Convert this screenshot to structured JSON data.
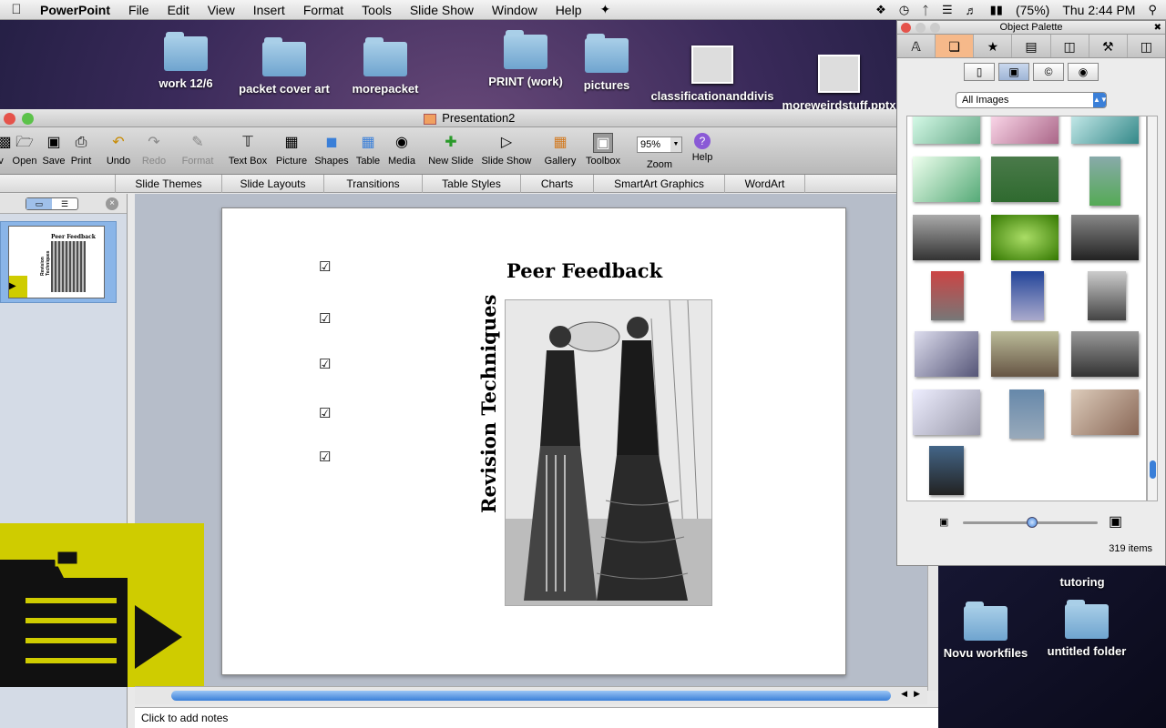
{
  "menubar": {
    "app": "PowerPoint",
    "items": [
      "File",
      "Edit",
      "View",
      "Insert",
      "Format",
      "Tools",
      "Slide Show",
      "Window",
      "Help"
    ],
    "battery": "(75%)",
    "clock": "Thu 2:44 PM"
  },
  "desktop": {
    "icons": [
      {
        "label": "work 12/6",
        "kind": "folder"
      },
      {
        "label": "packet cover art",
        "kind": "folder"
      },
      {
        "label": "morepacket",
        "kind": "folder"
      },
      {
        "label": "PRINT (work)",
        "kind": "folder"
      },
      {
        "label": "pictures",
        "kind": "folder"
      },
      {
        "label": "classificationanddivis",
        "kind": "doc"
      },
      {
        "label": "moreweirdstuff.pptx",
        "kind": "doc"
      }
    ],
    "lower": [
      "tutoring",
      "Novu workfiles",
      "untitled folder"
    ]
  },
  "window": {
    "title": "Presentation2",
    "toolbar": [
      {
        "label": "v",
        "icon": "new-icon"
      },
      {
        "label": "Open",
        "icon": "open-icon"
      },
      {
        "label": "Save",
        "icon": "save-icon"
      },
      {
        "label": "Print",
        "icon": "print-icon"
      },
      {
        "label": "Undo",
        "icon": "undo-icon"
      },
      {
        "label": "Redo",
        "icon": "redo-icon"
      },
      {
        "label": "Format",
        "icon": "format-icon"
      },
      {
        "label": "Text Box",
        "icon": "textbox-icon"
      },
      {
        "label": "Picture",
        "icon": "picture-icon"
      },
      {
        "label": "Shapes",
        "icon": "shapes-icon"
      },
      {
        "label": "Table",
        "icon": "table-icon"
      },
      {
        "label": "Media",
        "icon": "media-icon"
      },
      {
        "label": "New Slide",
        "icon": "new-slide-icon"
      },
      {
        "label": "Slide Show",
        "icon": "slide-show-icon"
      },
      {
        "label": "Gallery",
        "icon": "gallery-icon"
      },
      {
        "label": "Toolbox",
        "icon": "toolbox-icon"
      },
      {
        "label": "Zoom",
        "icon": "zoom-icon"
      },
      {
        "label": "Help",
        "icon": "help-icon"
      }
    ],
    "zoom_value": "95%",
    "ribbon_tabs": [
      "Slide Themes",
      "Slide Layouts",
      "Transitions",
      "Table Styles",
      "Charts",
      "SmartArt Graphics",
      "WordArt"
    ],
    "notes_placeholder": "Click to add notes"
  },
  "slide": {
    "title": "Peer Feedback",
    "vertical_text": "Revision Techniques",
    "checkbox_glyph": "☑",
    "thumb_title": "Peer Feedback",
    "thumb_vertical": "Revision Techniques"
  },
  "palette": {
    "title": "Object Palette",
    "filter": "All Images",
    "item_count": "319 items"
  }
}
